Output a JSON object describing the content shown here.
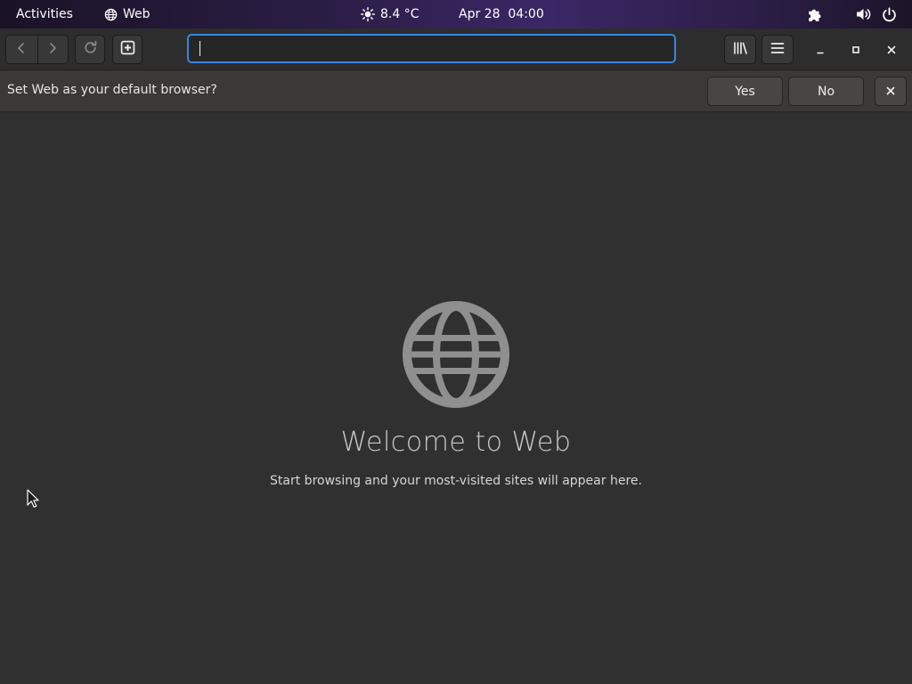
{
  "topbar": {
    "activities": "Activities",
    "app_name": "Web",
    "weather": "8.4 °C",
    "clock": "Apr 28  04:00"
  },
  "url_entry": {
    "value": ""
  },
  "infobar": {
    "message": "Set Web as your default browser?",
    "yes_label": "Yes",
    "no_label": "No"
  },
  "welcome": {
    "title": "Welcome to Web",
    "subtitle": "Start browsing and your most-visited sites will appear here."
  },
  "colors": {
    "accent": "#3584e4",
    "background": "#303030",
    "globe": "#8f8f8f"
  },
  "icons": [
    "globe-icon",
    "sun-icon",
    "puzzle-icon",
    "speaker-icon",
    "power-icon",
    "back-icon",
    "forward-icon",
    "reload-icon",
    "new-tab-icon",
    "library-icon",
    "hamburger-menu-icon",
    "minimize-icon",
    "maximize-icon",
    "close-icon",
    "mouse-pointer-icon"
  ]
}
